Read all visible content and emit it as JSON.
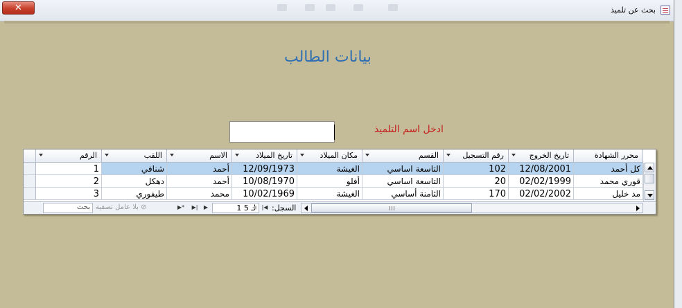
{
  "window": {
    "title": "بحث عن تلميذ",
    "close_glyph": "✕"
  },
  "form": {
    "heading": "بيانات الطالب",
    "search_label": "ادخل اسم التلميذ",
    "search_value": ""
  },
  "grid": {
    "columns": [
      {
        "key": "num",
        "label": "الرقم"
      },
      {
        "key": "surname",
        "label": "اللقب"
      },
      {
        "key": "name",
        "label": "الاسم"
      },
      {
        "key": "dob",
        "label": "تاريخ الميلاد"
      },
      {
        "key": "pob",
        "label": "مكان الميلاد"
      },
      {
        "key": "section",
        "label": "القسم"
      },
      {
        "key": "reg",
        "label": "رقم التسجيل"
      },
      {
        "key": "exit",
        "label": "تاريخ الخروج"
      },
      {
        "key": "certifier",
        "label": "محرر الشهادة"
      }
    ],
    "rows": [
      {
        "num": "1",
        "surname": "شنافي",
        "name": "أحمد",
        "dob": "12/09/1973",
        "pob": "الغيشة",
        "section": "التاسعة اساسي",
        "reg": "102",
        "exit": "12/08/2001",
        "certifier": "كل أحمد"
      },
      {
        "num": "2",
        "surname": "دهكل",
        "name": "أحمد",
        "dob": "10/08/1970",
        "pob": "أفلو",
        "section": "التاسعة اساسي",
        "reg": "20",
        "exit": "02/02/1999",
        "certifier": "قوري محمد"
      },
      {
        "num": "3",
        "surname": "طيفوري",
        "name": "محمد",
        "dob": "10/02/1969",
        "pob": "الغيشة",
        "section": "الثامنة أساسي",
        "reg": "170",
        "exit": "02/02/2002",
        "certifier": "مد خليل"
      }
    ]
  },
  "navigator": {
    "record_label": "السجل:",
    "record_position": "1 لـ 5",
    "filter_label": "بلا عامل تصفية",
    "search_placeholder": "بحث"
  }
}
